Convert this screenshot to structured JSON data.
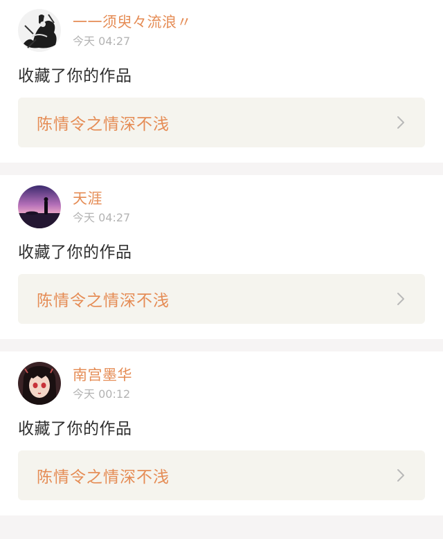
{
  "notifications": [
    {
      "username": "一一须臾々流浪〃",
      "time": "今天 04:27",
      "action": "收藏了你的作品",
      "work_title": "陈情令之情深不浅",
      "avatar_icon": "ink-figure-avatar"
    },
    {
      "username": "天涯",
      "time": "今天 04:27",
      "action": "收藏了你的作品",
      "work_title": "陈情令之情深不浅",
      "avatar_icon": "purple-sunset-silhouette-avatar"
    },
    {
      "username": "南宫墨华",
      "time": "今天 00:12",
      "action": "收藏了你的作品",
      "work_title": "陈情令之情深不浅",
      "avatar_icon": "anime-girl-avatar"
    }
  ],
  "colors": {
    "accent": "#e58c55",
    "link_bg": "#f5f4ee",
    "page_bg": "#f6f4f4"
  }
}
